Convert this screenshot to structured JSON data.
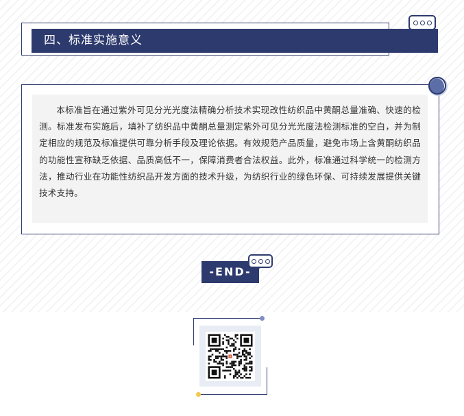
{
  "section": {
    "title": "四、标准实施意义"
  },
  "content": {
    "paragraph": "本标准旨在通过紫外可见分光光度法精确分析技术实现改性纺织品中黄酮总量准确、快速的检测。标准发布实施后，填补了纺织品中黄酮总量测定紫外可见分光光度法检测标准的空白，并为制定相应的规范及标准提供可靠分析手段及理论依据。有效规范产品质量，避免市场上含黄酮纺织品的功能性宣称缺乏依据、品质高低不一，保障消费者合法权益。此外，标准通过科学统一的检测方法，推动行业在功能性纺织品开发方面的技术升级，为纺织行业的绿色环保、可持续发展提供关键技术支持。"
  },
  "end": {
    "label": "-END-"
  },
  "colors": {
    "accent": "#2d3a6e",
    "panel": "#f3f3f3",
    "dot_blue": "#7f8fc6",
    "dot_yellow": "#f2c94c"
  },
  "icons": {
    "title_bubble": "speech-bubble-icon",
    "end_bubble": "speech-bubble-icon",
    "qr": "qr-code-icon"
  }
}
